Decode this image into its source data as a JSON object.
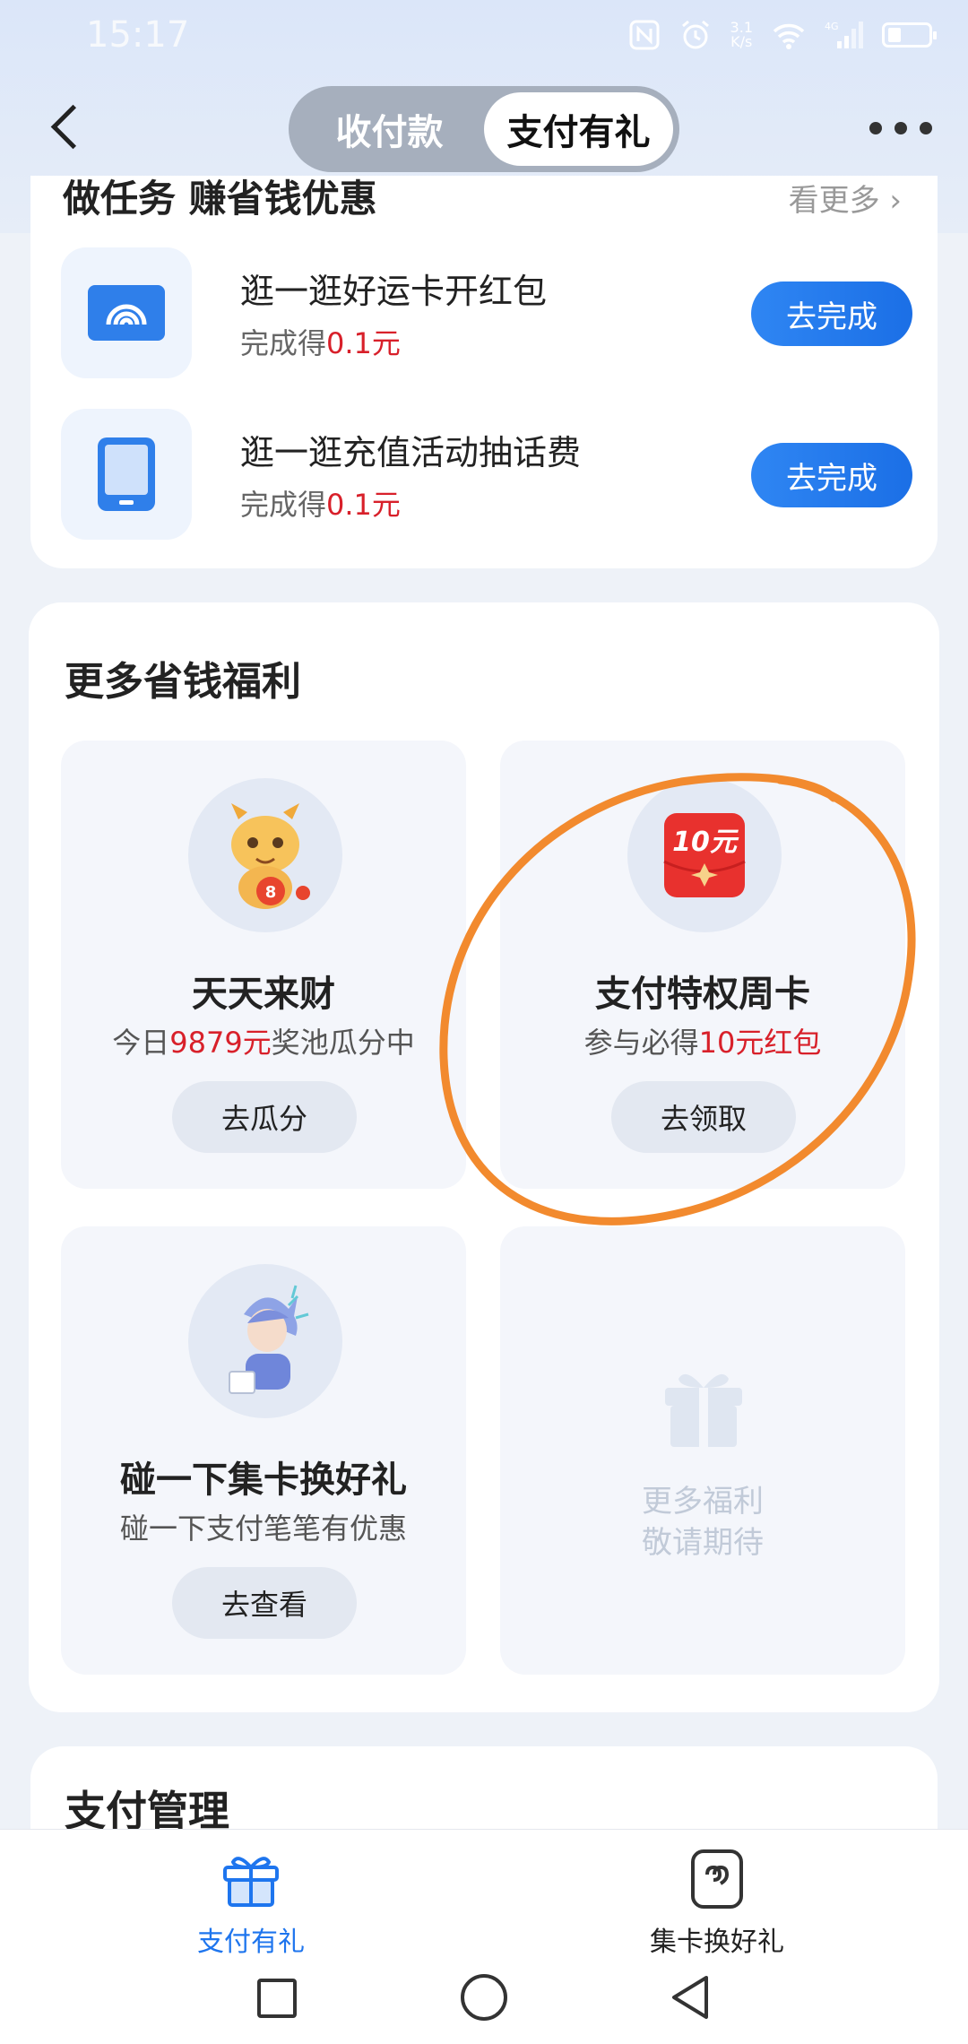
{
  "status_bar": {
    "time": "15:17",
    "speed_value": "3.1",
    "speed_unit": "K/s",
    "network": "4G"
  },
  "nav": {
    "segment_inactive": "收付款",
    "segment_active": "支付有礼"
  },
  "tasks": {
    "title": "做任务 赚省钱优惠",
    "see_more": "看更多 ›",
    "items": [
      {
        "title": "逛一逛好运卡开红包",
        "reward_prefix": "完成得",
        "reward_amount": "0.1元",
        "button": "去完成",
        "icon": "wifi-card-icon"
      },
      {
        "title": "逛一逛充值活动抽话费",
        "reward_prefix": "完成得",
        "reward_amount": "0.1元",
        "button": "去完成",
        "icon": "phone-icon"
      }
    ]
  },
  "benefits": {
    "title": "更多省钱福利",
    "items": [
      {
        "title": "天天来财",
        "sub_prefix": "今日",
        "sub_red": "9879元",
        "sub_suffix": "奖池瓜分中",
        "button": "去瓜分",
        "icon": "dragon-mascot-icon",
        "badge": "8"
      },
      {
        "title": "支付特权周卡",
        "sub_prefix": "参与必得",
        "sub_red": "10元红包",
        "sub_suffix": "",
        "button": "去领取",
        "icon": "red-envelope-icon",
        "badge": "10元"
      },
      {
        "title": "碰一下集卡换好礼",
        "sub_prefix": "碰一下支付笔笔有优惠",
        "sub_red": "",
        "sub_suffix": "",
        "button": "去查看",
        "icon": "character-mascot-icon"
      },
      {
        "line1": "更多福利",
        "line2": "敬请期待",
        "icon": "gift-icon"
      }
    ]
  },
  "payment_mgmt": {
    "title": "支付管理"
  },
  "tabbar": {
    "tabs": [
      {
        "label": "支付有礼",
        "icon": "gift-icon",
        "active": true
      },
      {
        "label": "集卡换好礼",
        "icon": "card-collect-icon",
        "active": false
      }
    ]
  },
  "colors": {
    "accent_blue": "#1e75ee",
    "reward_red": "#d8202a",
    "annotation_orange": "#f28a2e"
  }
}
